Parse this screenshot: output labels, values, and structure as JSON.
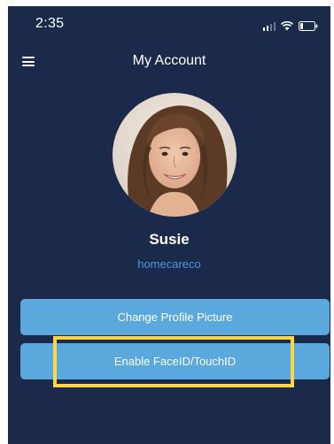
{
  "status_bar": {
    "time": "2:35",
    "signal_icon": "cellular-signal-icon",
    "wifi_icon": "wifi-icon",
    "battery_icon": "battery-low-icon"
  },
  "header": {
    "menu_icon": "hamburger-menu-icon",
    "title": "My Account"
  },
  "profile": {
    "name": "Susie",
    "company": "homecareco"
  },
  "actions": {
    "change_picture_label": "Change Profile Picture",
    "enable_biometric_label": "Enable FaceID/TouchID"
  },
  "colors": {
    "background": "#1b2a4b",
    "button": "#5aa8dc",
    "company_text": "#4a9ad6",
    "highlight": "#ffd447"
  }
}
